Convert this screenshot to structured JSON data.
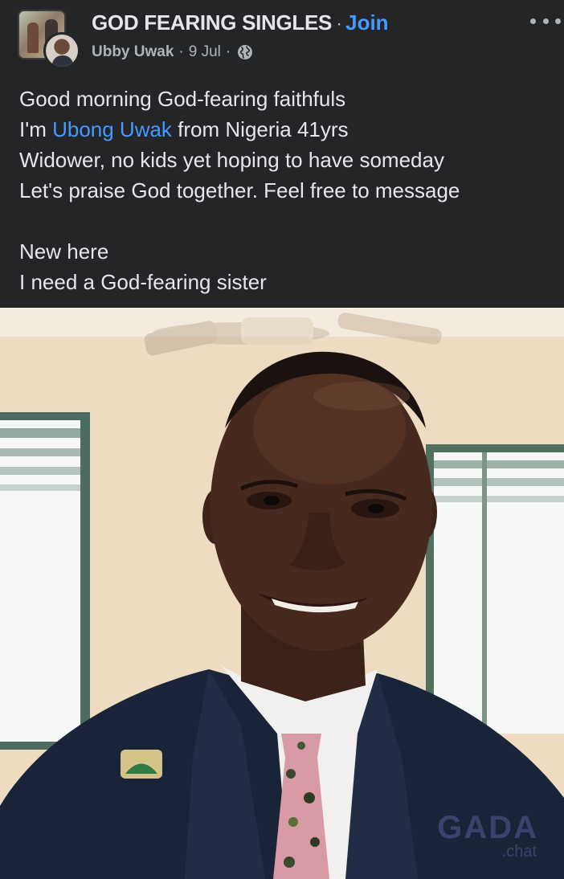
{
  "post": {
    "group_name": "GOD FEARING SINGLES",
    "separator": "·",
    "join_label": "Join",
    "author": "Ubby Uwak",
    "date": "9 Jul",
    "meta_separator": "·",
    "privacy_icon": "globe-icon",
    "more_icon": "more-options-icon",
    "body": {
      "line1": "Good morning God-fearing faithfuls",
      "line2_prefix": "I'm ",
      "line2_mention": "Ubong Uwak",
      "line2_suffix": " from Nigeria 41yrs",
      "line3": "Widower, no kids yet hoping to have someday",
      "line4": "Let's praise God together. Feel free to message",
      "line5": "New here",
      "line6": "I need a God-fearing sister"
    }
  },
  "watermark": {
    "main": "GADA",
    "sub": ".chat"
  },
  "colors": {
    "background": "#242526",
    "text": "#e4e6eb",
    "secondary_text": "#b0b3b8",
    "link": "#4599ff"
  }
}
